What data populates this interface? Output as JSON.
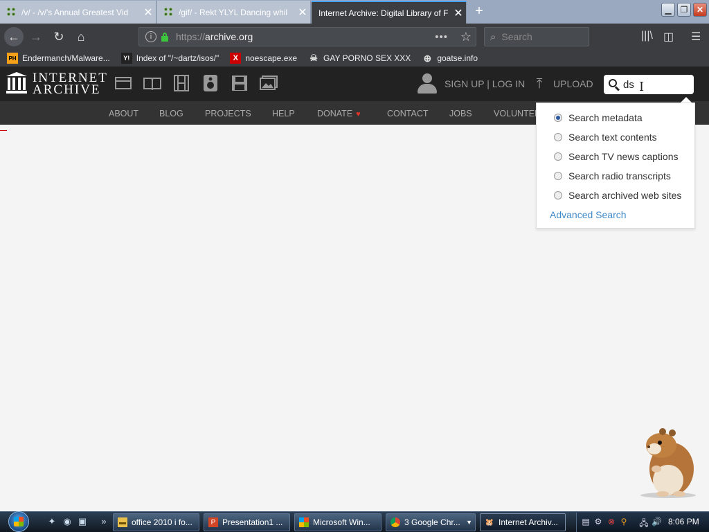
{
  "browser": {
    "tabs": [
      {
        "title": "/v/ - /v/'s Annual Greatest Vid",
        "icon": "clover-icon"
      },
      {
        "title": "/gif/ - Rekt YLYL Dancing whil",
        "icon": "clover-icon"
      },
      {
        "title": "Internet Archive: Digital Library of F",
        "icon": "none"
      }
    ],
    "new_tab": "+",
    "url": {
      "protocol": "https://",
      "host": "archive.org"
    },
    "search_placeholder": "Search",
    "bookmarks": [
      {
        "label": "Endermanch/Malware...",
        "badge": "PH"
      },
      {
        "label": "Index of \"/~dartz/isos/\"",
        "badge": "Y!"
      },
      {
        "label": "noescape.exe",
        "badge": "X"
      },
      {
        "label": "GAY PORNO SEX XXX",
        "badge": "☠"
      },
      {
        "label": "goatse.info",
        "badge": "⊕"
      }
    ]
  },
  "archive": {
    "brand_line1": "INTERNET",
    "brand_line2": "ARCHIVE",
    "auth": "SIGN UP | LOG IN",
    "upload": "UPLOAD",
    "search_value": "ds",
    "nav": [
      "ABOUT",
      "BLOG",
      "PROJECTS",
      "HELP",
      "DONATE",
      "CONTACT",
      "JOBS",
      "VOLUNTEE"
    ],
    "dropdown": {
      "options": [
        {
          "label": "Search metadata",
          "selected": true
        },
        {
          "label": "Search text contents",
          "selected": false
        },
        {
          "label": "Search TV news captions",
          "selected": false
        },
        {
          "label": "Search radio transcripts",
          "selected": false
        },
        {
          "label": "Search archived web sites",
          "selected": false
        }
      ],
      "advanced": "Advanced Search"
    }
  },
  "taskbar": {
    "items": [
      {
        "label": "office 2010 i fo...",
        "icon": "folder-icon"
      },
      {
        "label": "Presentation1 ...",
        "icon": "powerpoint-icon"
      },
      {
        "label": "Microsoft Win...",
        "icon": "windows-icon"
      },
      {
        "label": "3 Google Chr...",
        "icon": "chrome-icon"
      },
      {
        "label": "Internet Archiv...",
        "icon": "firefox-icon"
      }
    ],
    "clock": "8:06 PM"
  },
  "colors": {
    "browser_chrome": "#3b3d41",
    "archive_header": "#222222",
    "archive_nav": "#333333",
    "link_blue": "#428bca",
    "donate_heart": "#e0342b"
  }
}
